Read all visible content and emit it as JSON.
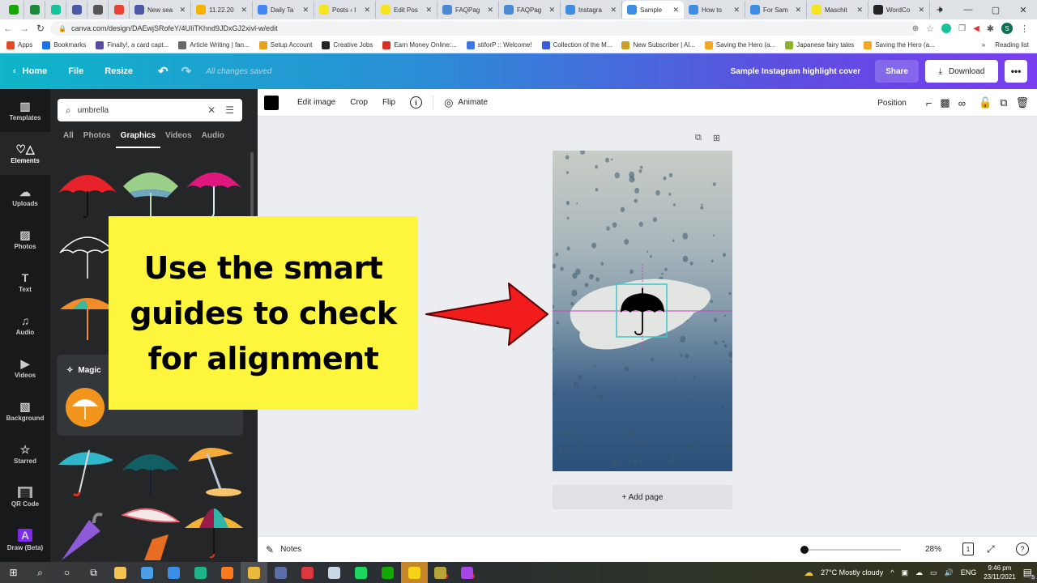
{
  "browser": {
    "tabs": [
      {
        "label": "",
        "icon": "upwork-icon",
        "color": "#14a800",
        "pinned": true
      },
      {
        "label": "",
        "icon": "green-plus-icon",
        "color": "#1b8a3a",
        "pinned": true
      },
      {
        "label": "",
        "icon": "grammarly-icon",
        "color": "#15c39a",
        "pinned": true
      },
      {
        "label": "",
        "icon": "stripes-icon",
        "color": "#4a5aa8",
        "pinned": true
      },
      {
        "label": "",
        "icon": "h-icon",
        "color": "#555555",
        "pinned": true
      },
      {
        "label": "",
        "icon": "gmail-icon",
        "color": "#ea4335",
        "pinned": true
      },
      {
        "label": "New sea",
        "icon": "stripes-icon",
        "color": "#4a5aa8"
      },
      {
        "label": "11.22.20",
        "icon": "google-drive-icon",
        "color": "#f4b400"
      },
      {
        "label": "Daily Ta",
        "icon": "google-docs-icon",
        "color": "#4285f4"
      },
      {
        "label": "Posts ‹ I",
        "icon": "mt-icon",
        "color": "#f4e51e"
      },
      {
        "label": "Edit Pos",
        "icon": "mt-icon",
        "color": "#f4e51e"
      },
      {
        "label": "FAQPag",
        "icon": "braces-icon",
        "color": "#4a8ad4"
      },
      {
        "label": "FAQPag",
        "icon": "braces-icon",
        "color": "#4a8ad4"
      },
      {
        "label": "Instagra",
        "icon": "canva-icon",
        "color": "#3d8ee3"
      },
      {
        "label": "Sample",
        "icon": "canva-icon",
        "color": "#3d8ee3",
        "active": true
      },
      {
        "label": "How to",
        "icon": "canva-icon",
        "color": "#3d8ee3"
      },
      {
        "label": "For Sam",
        "icon": "canva-icon",
        "color": "#3d8ee3"
      },
      {
        "label": "Maschit",
        "icon": "mt-icon",
        "color": "#f4e51e"
      },
      {
        "label": "WordCo",
        "icon": "w-icon",
        "color": "#222222"
      }
    ],
    "tab_close": "✕",
    "new_tab": "+",
    "url": "canva.com/design/DAEwjSRofeY/4UIiTKhnd9JDxGJ2xivl-w/edit",
    "bookmarks": [
      {
        "label": "Apps",
        "color": "#e34c26"
      },
      {
        "label": "Bookmarks",
        "color": "#1a73e8"
      },
      {
        "label": "Finally!, a card capt...",
        "color": "#5a4aa8"
      },
      {
        "label": "Article Writing | fan...",
        "color": "#666666"
      },
      {
        "label": "Setup Account",
        "color": "#e8a21a"
      },
      {
        "label": "Creative Jobs",
        "color": "#222222"
      },
      {
        "label": "Earn Money Online:...",
        "color": "#d93025"
      },
      {
        "label": "stiforP :: Welcome!",
        "color": "#3b78e7"
      },
      {
        "label": "Collection of the M...",
        "color": "#3b5bdb"
      },
      {
        "label": "New Subscriber | Al...",
        "color": "#c9a227"
      },
      {
        "label": "Saving the Hero (a...",
        "color": "#f4a71e"
      },
      {
        "label": "Japanese fairy tales",
        "color": "#8bb42a"
      },
      {
        "label": "Saving the Hero (a...",
        "color": "#f4a71e"
      }
    ],
    "bookmarks_overflow": "»",
    "reading_list": "Reading list",
    "profile_initial": "S"
  },
  "topbar": {
    "home": "Home",
    "file": "File",
    "resize": "Resize",
    "saved_status": "All changes saved",
    "design_title": "Sample Instagram highlight cover",
    "share": "Share",
    "download": "Download",
    "more": "•••"
  },
  "rail": [
    {
      "label": "Templates",
      "icon": "▥"
    },
    {
      "label": "Elements",
      "icon": "♡△",
      "active": true
    },
    {
      "label": "Uploads",
      "icon": "☁"
    },
    {
      "label": "Photos",
      "icon": "▨"
    },
    {
      "label": "Text",
      "icon": "T"
    },
    {
      "label": "Audio",
      "icon": "♫"
    },
    {
      "label": "Videos",
      "icon": "▶"
    },
    {
      "label": "Background",
      "icon": "▧"
    },
    {
      "label": "Starred",
      "icon": "☆"
    },
    {
      "label": "QR Code",
      "icon": "▦"
    },
    {
      "label": "Draw (Beta)",
      "icon": "A"
    }
  ],
  "panel": {
    "search_value": "umbrella",
    "tabs": [
      "All",
      "Photos",
      "Graphics",
      "Videos",
      "Audio"
    ],
    "active_tab": "Graphics",
    "magic_title": "Magic"
  },
  "context_toolbar": {
    "color": "#000000",
    "edit_image": "Edit image",
    "crop": "Crop",
    "flip": "Flip",
    "animate": "Animate",
    "position": "Position"
  },
  "canvas": {
    "add_page": "+ Add page"
  },
  "annotation": {
    "text": "Use the smart guides to check for alignment",
    "background": "#fef63c",
    "arrow_color": "#f21c1c"
  },
  "footer": {
    "notes": "Notes",
    "zoom": "28%",
    "page_count": "1",
    "help": "?"
  },
  "taskbar": {
    "apps": [
      {
        "name": "start",
        "glyph": "⊞",
        "color": "#ffffff"
      },
      {
        "name": "search",
        "glyph": "⌕",
        "color": "#ffffff"
      },
      {
        "name": "cortana",
        "glyph": "○",
        "color": "#ffffff"
      },
      {
        "name": "task-view",
        "glyph": "⧉",
        "color": "#ffffff"
      },
      {
        "name": "file-explorer",
        "color": "#f2c14e"
      },
      {
        "name": "store",
        "color": "#4a9ee8"
      },
      {
        "name": "mail",
        "color": "#3a8ee6"
      },
      {
        "name": "edge",
        "color": "#1fb38a"
      },
      {
        "name": "firefox",
        "color": "#ff7a1a"
      },
      {
        "name": "chrome",
        "color": "#e8b93a",
        "active": true
      },
      {
        "name": "calculator",
        "color": "#5a6ea8"
      },
      {
        "name": "express-vpn",
        "color": "#da3940"
      },
      {
        "name": "paint",
        "color": "#c8d6e6"
      },
      {
        "name": "spotify",
        "color": "#1ed760"
      },
      {
        "name": "upwork",
        "color": "#14a800"
      },
      {
        "name": "sticky-notes",
        "color": "#f7d318"
      },
      {
        "name": "game",
        "color": "#b8a23a",
        "badge": "4"
      },
      {
        "name": "messenger",
        "color": "#a845e8",
        "badge": "2"
      }
    ],
    "weather": "27°C  Mostly cloudy",
    "lang": "ENG",
    "time": "9:46 pm",
    "date": "23/11/2021",
    "notifications": "5"
  }
}
